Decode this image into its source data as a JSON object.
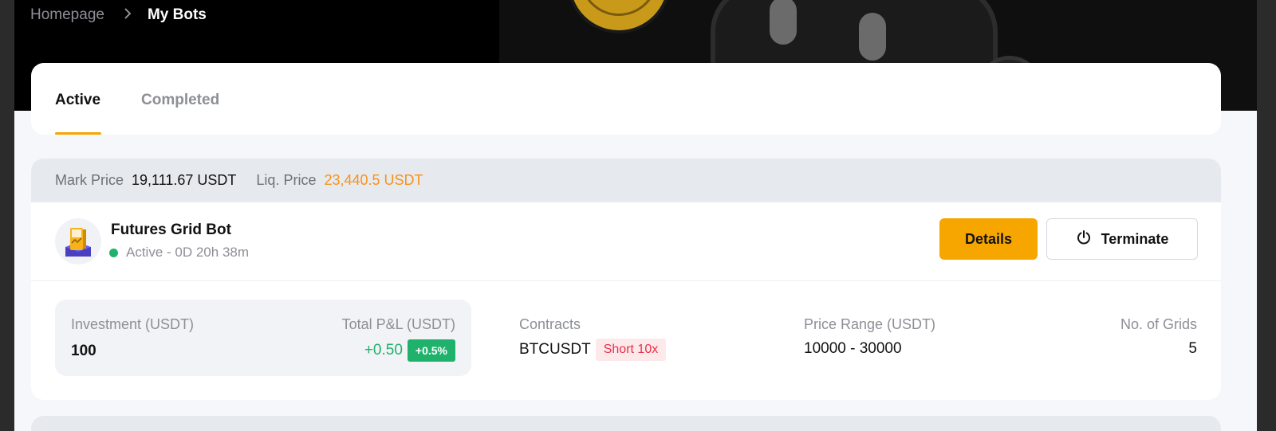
{
  "breadcrumb": {
    "home": "Homepage",
    "separator": ">",
    "current": "My Bots"
  },
  "tabs": [
    {
      "label": "Active",
      "selected": true
    },
    {
      "label": "Completed",
      "selected": false
    }
  ],
  "price_bar": {
    "mark_label": "Mark Price",
    "mark_value": "19,111.67 USDT",
    "liq_label": "Liq. Price",
    "liq_value": "23,440.5 USDT"
  },
  "bot": {
    "name": "Futures Grid Bot",
    "status": "Active - 0D 20h 38m",
    "details_label": "Details",
    "terminate_label": "Terminate",
    "investment_label": "Investment (USDT)",
    "investment_value": "100",
    "pnl_label": "Total P&L (USDT)",
    "pnl_value": "+0.50",
    "pnl_pct": "+0.5%",
    "contracts_label": "Contracts",
    "contracts_value": "BTCUSDT",
    "contracts_badge": "Short 10x",
    "range_label": "Price Range (USDT)",
    "range_value": "10000 - 30000",
    "grids_label": "No. of Grids",
    "grids_value": "5"
  },
  "colors": {
    "accent": "#f7a600",
    "profit": "#20b26c",
    "short": "#e8304b",
    "liq": "#f7931a"
  },
  "icons": {
    "chevron": "chevron-right-icon",
    "power": "power-icon",
    "bot_avatar": "grid-bot-avatar"
  }
}
